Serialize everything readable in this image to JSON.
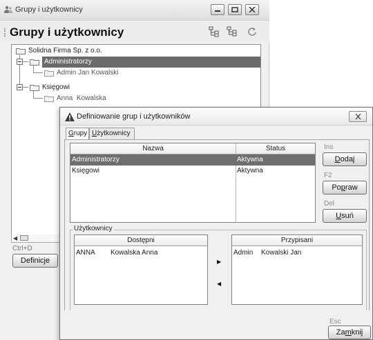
{
  "main_window": {
    "title": "Grupy i użytkownicy",
    "header_title": "Grupy i użytkownicy",
    "tree": {
      "root": "Solidna Firma Sp. z o.o.",
      "groups": [
        {
          "label": "Administratorzy",
          "users": [
            "Admin Jan Kowalski"
          ]
        },
        {
          "label": "Księgowi",
          "users": [
            "Anna  Kowalska"
          ]
        }
      ]
    },
    "shortcut": "Ctrl+D",
    "definitions_button": "Definicje"
  },
  "dialog": {
    "title": "Definiowanie grup i użytkowników",
    "tabs": [
      {
        "prefix": "",
        "underline": "G",
        "rest": "rupy"
      },
      {
        "prefix": "",
        "underline": "U",
        "rest": "żytkownicy"
      }
    ],
    "groups_table": {
      "headers": [
        "Nazwa",
        "Status"
      ],
      "rows": [
        {
          "name": "Administratorzy",
          "status": "Aktywna"
        },
        {
          "name": "Księgowi",
          "status": "Aktywna"
        }
      ]
    },
    "actions": {
      "add": {
        "shortcut": "Ins",
        "underline": "D",
        "rest": "odaj"
      },
      "edit": {
        "shortcut": "F2",
        "prefix": "Po",
        "underline": "p",
        "rest": "raw"
      },
      "delete": {
        "shortcut": "Del",
        "underline": "U",
        "rest": "suń"
      }
    },
    "users_section": {
      "legend": "Użytkownicy",
      "available": {
        "header": "Dostępni",
        "rows": [
          {
            "login": "ANNA",
            "name": "Kowalska Anna"
          }
        ]
      },
      "assigned": {
        "header": "Przypisani",
        "rows": [
          {
            "login": "Admin",
            "name": "Kowalski Jan"
          }
        ]
      }
    },
    "close": {
      "shortcut": "Esc",
      "prefix": "Za",
      "underline": "m",
      "rest": "knij"
    }
  },
  "colors": {
    "selection": "#6e6e6e",
    "tree_selection": "#6a6a6a",
    "window_bg": "#f0f0f0"
  }
}
